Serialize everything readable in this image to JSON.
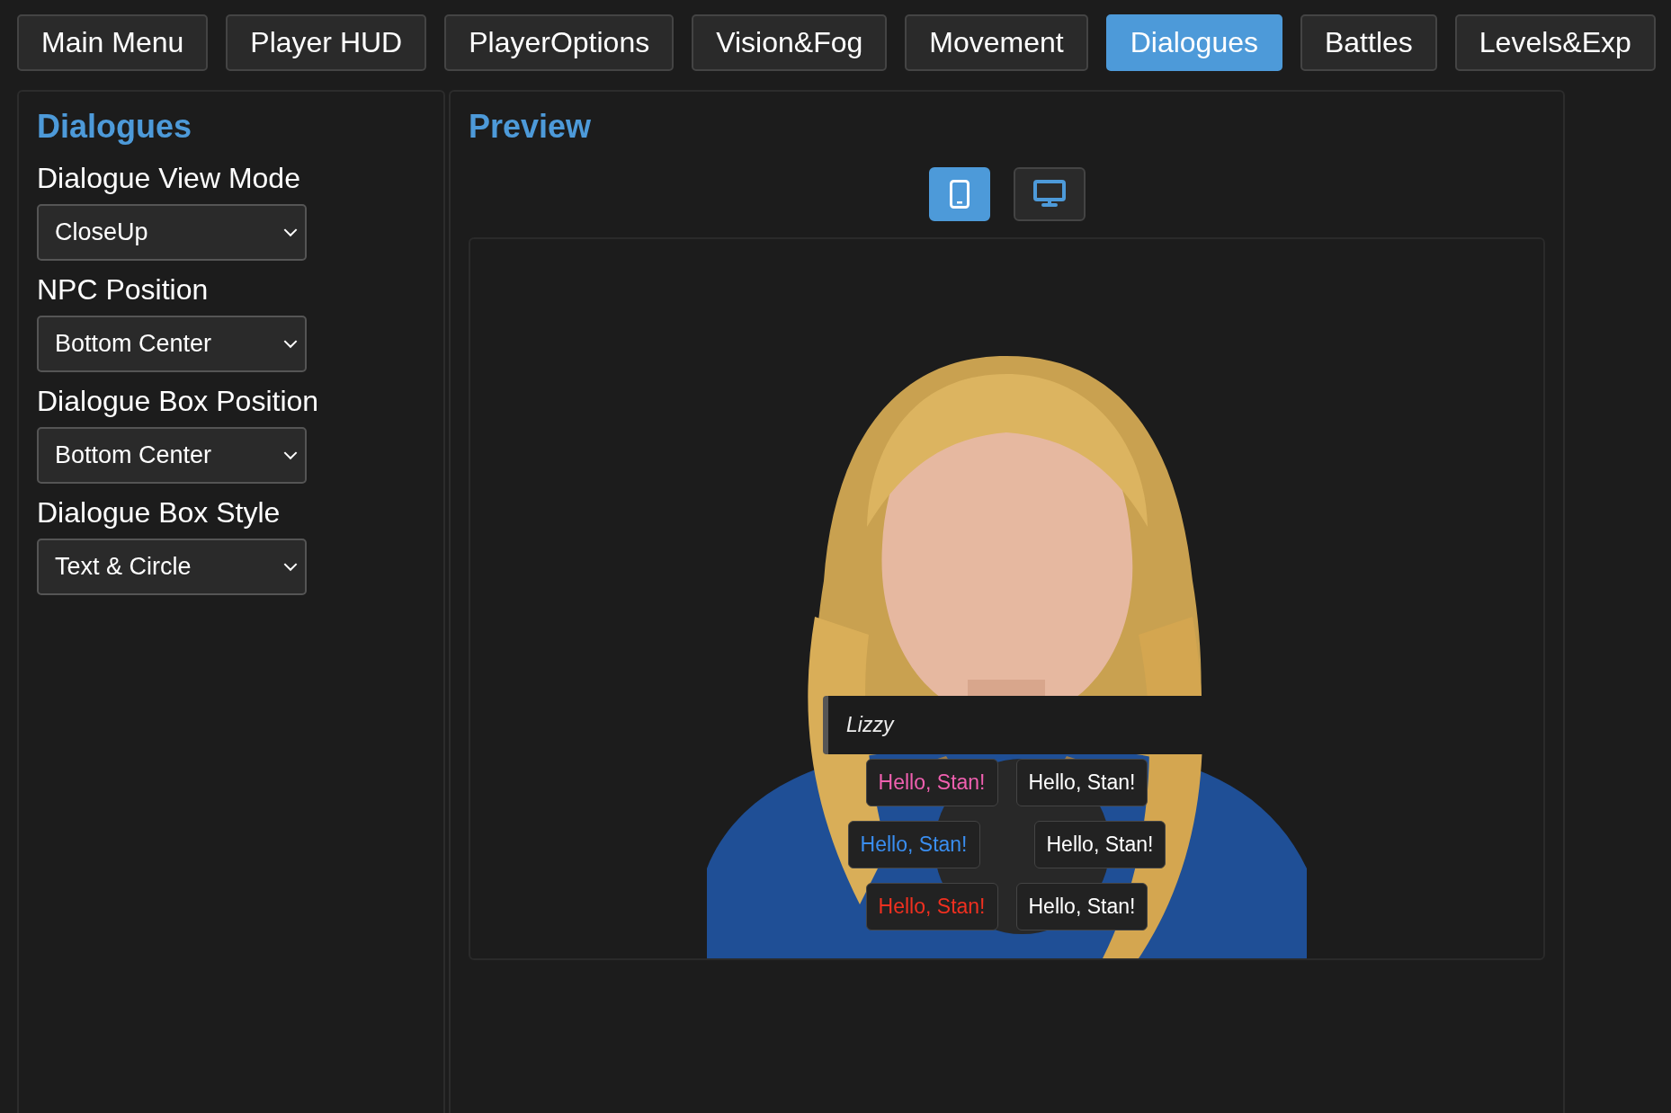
{
  "tabs": [
    {
      "label": "Main Menu",
      "selected": false
    },
    {
      "label": "Player HUD",
      "selected": false
    },
    {
      "label": "PlayerOptions",
      "selected": false
    },
    {
      "label": "Vision&Fog",
      "selected": false
    },
    {
      "label": "Movement",
      "selected": false
    },
    {
      "label": "Dialogues",
      "selected": true
    },
    {
      "label": "Battles",
      "selected": false
    },
    {
      "label": "Levels&Exp",
      "selected": false
    }
  ],
  "settings": {
    "title": "Dialogues",
    "fields": [
      {
        "label": "Dialogue View Mode",
        "value": "CloseUp"
      },
      {
        "label": "NPC Position",
        "value": "Bottom Center"
      },
      {
        "label": "Dialogue Box Position",
        "value": "Bottom Center"
      },
      {
        "label": "Dialogue Box Style",
        "value": "Text & Circle"
      }
    ]
  },
  "preview": {
    "title": "Preview",
    "devices": [
      {
        "kind": "phone",
        "selected": true
      },
      {
        "kind": "desktop",
        "selected": false
      }
    ],
    "speaker": "Lizzy",
    "options": [
      {
        "text": "Hello, Stan!",
        "color": "#f060b0"
      },
      {
        "text": "Hello, Stan!",
        "color": "#ffffff"
      },
      {
        "text": "Hello, Stan!",
        "color": "#3a8ef0"
      },
      {
        "text": "Hello, Stan!",
        "color": "#ffffff"
      },
      {
        "text": "Hello, Stan!",
        "color": "#f03020"
      },
      {
        "text": "Hello, Stan!",
        "color": "#ffffff"
      }
    ]
  }
}
